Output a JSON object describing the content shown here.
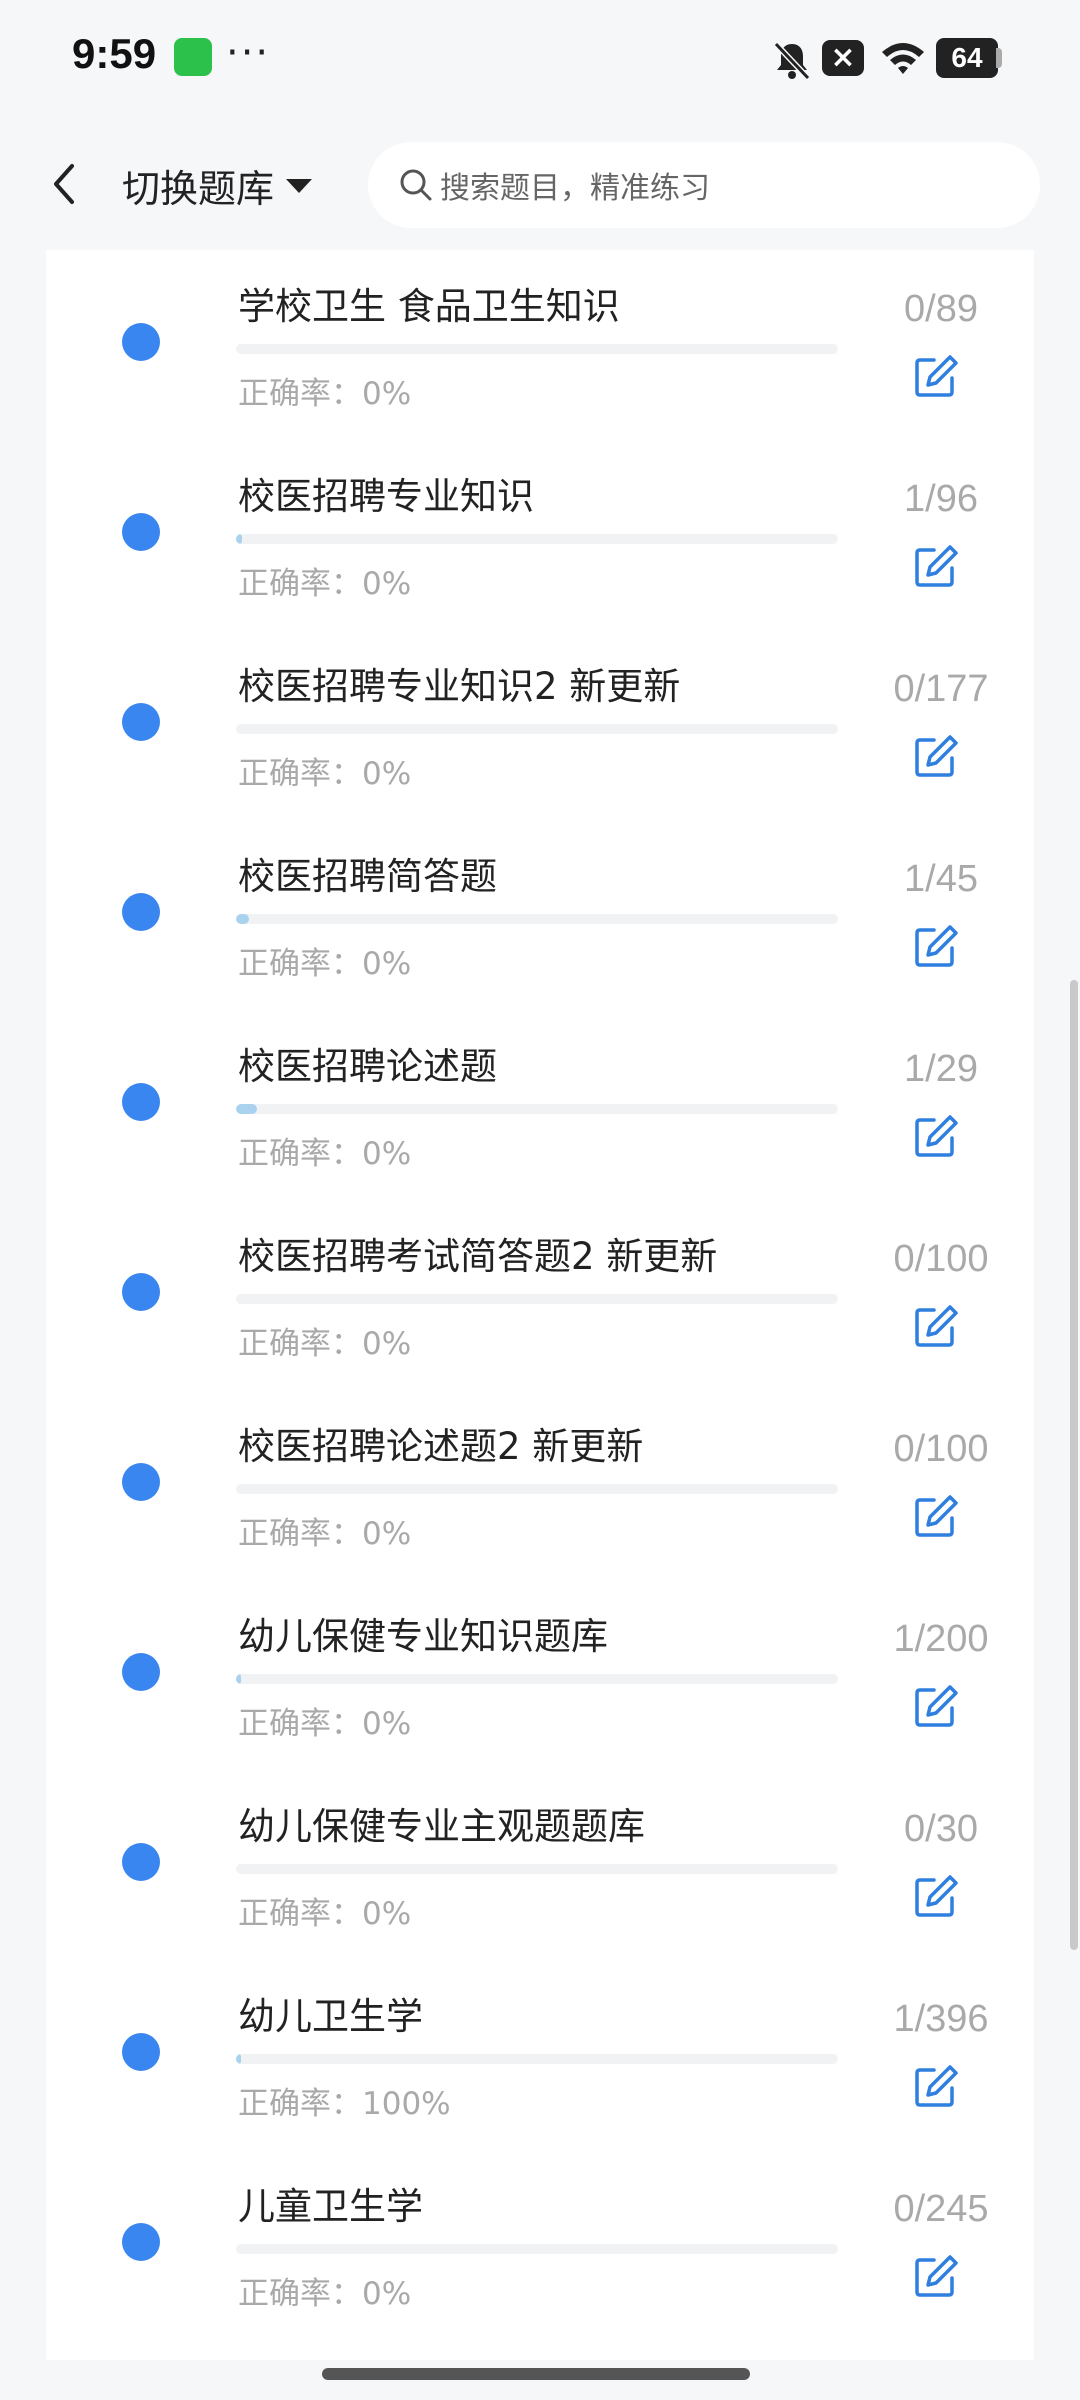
{
  "status_bar": {
    "time": "9:59",
    "dots": "···",
    "battery": "64",
    "icons": [
      "wechat-icon",
      "bell-off-icon",
      "close-box-icon",
      "wifi-icon",
      "battery-icon"
    ]
  },
  "header": {
    "switch_label": "切换题库",
    "search_placeholder": "搜索题目，精准练习"
  },
  "accuracy_prefix": "正确率：",
  "items": [
    {
      "title": "学校卫生 食品卫生知识",
      "accuracy": "正确率：0%",
      "count": "0/89",
      "progress": 0.0
    },
    {
      "title": "校医招聘专业知识",
      "accuracy": "正确率：0%",
      "count": "1/96",
      "progress": 0.0104
    },
    {
      "title": "校医招聘专业知识2 新更新",
      "accuracy": "正确率：0%",
      "count": "0/177",
      "progress": 0.0
    },
    {
      "title": "校医招聘简答题",
      "accuracy": "正确率：0%",
      "count": "1/45",
      "progress": 0.0222
    },
    {
      "title": "校医招聘论述题",
      "accuracy": "正确率：0%",
      "count": "1/29",
      "progress": 0.0345
    },
    {
      "title": "校医招聘考试简答题2 新更新",
      "accuracy": "正确率：0%",
      "count": "0/100",
      "progress": 0.0
    },
    {
      "title": "校医招聘论述题2 新更新",
      "accuracy": "正确率：0%",
      "count": "0/100",
      "progress": 0.0
    },
    {
      "title": "幼儿保健专业知识题库",
      "accuracy": "正确率：0%",
      "count": "1/200",
      "progress": 0.005
    },
    {
      "title": "幼儿保健专业主观题题库",
      "accuracy": "正确率：0%",
      "count": "0/30",
      "progress": 0.0
    },
    {
      "title": "幼儿卫生学",
      "accuracy": "正确率：100%",
      "count": "1/396",
      "progress": 0.0025
    },
    {
      "title": "儿童卫生学",
      "accuracy": "正确率：0%",
      "count": "0/245",
      "progress": 0.0
    }
  ],
  "colors": {
    "dot": "#3a86f0",
    "edit_icon": "#2f7fe0",
    "progress_fill": "#a9d2ef",
    "muted_text": "#a9a9a9"
  }
}
